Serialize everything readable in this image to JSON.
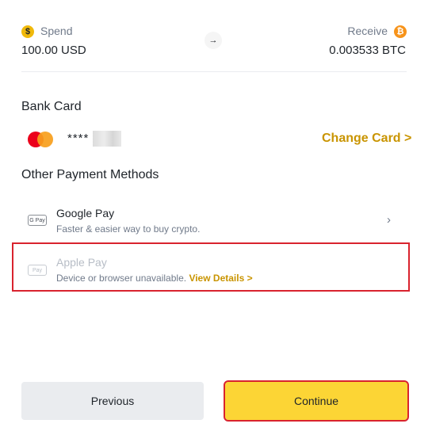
{
  "summary": {
    "spend_label": "Spend",
    "spend_amount": "100.00 USD",
    "spend_icon": "dollar-coin-icon",
    "receive_label": "Receive",
    "receive_amount": "0.003533 BTC",
    "receive_icon": "bitcoin-coin-icon",
    "arrow_glyph": "→",
    "usd_glyph": "$",
    "btc_glyph": "₿"
  },
  "bank_card": {
    "title": "Bank Card",
    "card_mask": "****",
    "change_label": "Change Card >"
  },
  "other_methods": {
    "title": "Other Payment Methods",
    "google_pay": {
      "icon_text": "G Pay",
      "name": "Google Pay",
      "description": "Faster & easier way to buy crypto.",
      "chevron": "›"
    },
    "apple_pay": {
      "icon_text": " Pay",
      "name": "Apple Pay",
      "description": "Device or browser unavailable.",
      "link": "View Details >"
    }
  },
  "actions": {
    "previous": "Previous",
    "continue": "Continue"
  },
  "colors": {
    "accent": "#f0b90b",
    "button_primary": "#fcd535",
    "link": "#c99400",
    "highlight": "#d9232e"
  }
}
